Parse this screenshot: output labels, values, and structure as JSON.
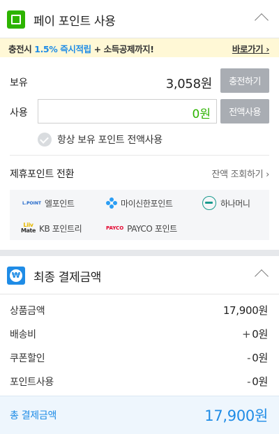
{
  "pay_point": {
    "title": "페이 포인트 사용",
    "banner": {
      "prefix": "충전시 ",
      "highlight": "1.5% 즉시적립",
      "suffix": " + 소득공제까지!",
      "link": "바로가기"
    },
    "holding": {
      "label": "보유",
      "value": "3,058원",
      "button": "충전하기"
    },
    "use": {
      "label": "사용",
      "value": "0원",
      "button": "전액사용"
    },
    "always_use_all": {
      "label": "항상 보유 포인트 전액사용",
      "checked": false
    },
    "partner": {
      "title": "제휴포인트 전환",
      "link": "잔액 조회하기",
      "items": [
        {
          "logo": "L.POINT",
          "name": "엘포인트"
        },
        {
          "logo": "shinhan-icon",
          "name": "마이신한포인트"
        },
        {
          "logo": "hana-icon",
          "name": "하나머니"
        },
        {
          "logo": "Liiv Mate",
          "name": "KB 포인트리"
        },
        {
          "logo": "PAYCO",
          "name": "PAYCO 포인트"
        }
      ]
    }
  },
  "final_payment": {
    "title": "최종 결제금액",
    "icon_text": "₩",
    "rows": [
      {
        "label": "상품금액",
        "sign": "",
        "value": "17,900원"
      },
      {
        "label": "배송비",
        "sign": "+",
        "value": "0원"
      },
      {
        "label": "쿠폰할인",
        "sign": "-",
        "value": "0원"
      },
      {
        "label": "포인트사용",
        "sign": "-",
        "value": "0원"
      }
    ],
    "total": {
      "label": "총 결제금액",
      "value": "17,900원"
    }
  },
  "colors": {
    "green": "#2db400",
    "blue": "#1f8ce6",
    "banner_bg": "#fff8d6",
    "gray_button": "#a9adb3"
  }
}
